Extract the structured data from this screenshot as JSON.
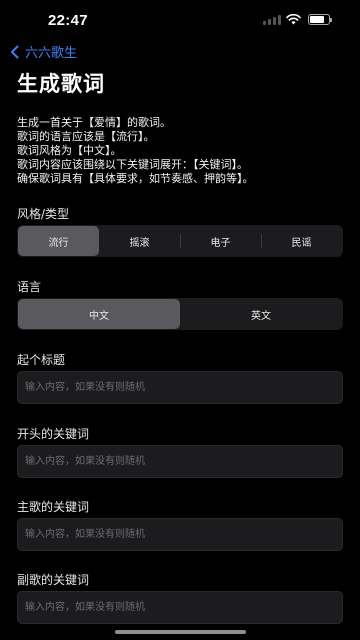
{
  "status_bar": {
    "time": "22:47",
    "battery_level": 0.75
  },
  "nav": {
    "back_label": "六六歌生"
  },
  "page_title": "生成歌词",
  "prompt_lines": [
    "生成一首关于【爱情】的歌词。",
    "歌词的语言应该是【流行】。",
    "歌词风格为【中文】。",
    "歌词内容应该围绕以下关键词展开：【关键词】。",
    "确保歌词具有【具体要求，如节奏感、押韵等】。"
  ],
  "style_section": {
    "label": "风格/类型",
    "options": [
      "流行",
      "摇滚",
      "电子",
      "民谣"
    ],
    "selected": "流行"
  },
  "language_section": {
    "label": "语言",
    "options": [
      "中文",
      "英文"
    ],
    "selected": "中文"
  },
  "fields": [
    {
      "label": "起个标题",
      "value": "",
      "placeholder": "输入内容，如果没有则随机"
    },
    {
      "label": "开头的关键词",
      "value": "",
      "placeholder": "输入内容，如果没有则随机"
    },
    {
      "label": "主歌的关键词",
      "value": "",
      "placeholder": "输入内容，如果没有则随机"
    },
    {
      "label": "副歌的关键词",
      "value": "",
      "placeholder": "输入内容，如果没有则随机"
    }
  ],
  "colors": {
    "accent": "#3b82f6",
    "background": "#000000",
    "control_background": "#1c1c1e",
    "selected_segment": "#5a5a5e"
  }
}
